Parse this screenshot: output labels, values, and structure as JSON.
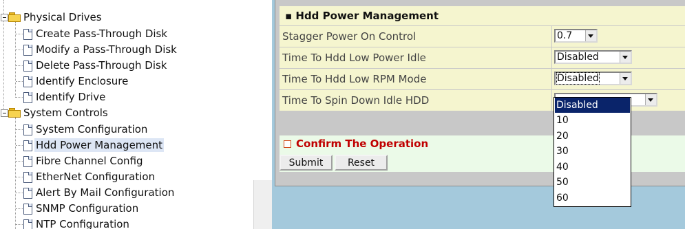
{
  "tree": {
    "groups": [
      {
        "label": "Physical Drives",
        "items": [
          "Create Pass-Through Disk",
          "Modify a Pass-Through Disk",
          "Delete Pass-Through Disk",
          "Identify Enclosure",
          "Identify Drive"
        ]
      },
      {
        "label": "System Controls",
        "items": [
          "System Configuration",
          "Hdd Power Management",
          "Fibre Channel Config",
          "EtherNet Configuration",
          "Alert By Mail Configuration",
          "SNMP Configuration",
          "NTP Configuration"
        ]
      }
    ],
    "selected_item": "Hdd Power Management"
  },
  "panel": {
    "title": "Hdd Power Management",
    "fields": [
      {
        "label": "Stagger Power On Control",
        "value": "0.7"
      },
      {
        "label": "Time To Hdd Low Power Idle",
        "value": "Disabled"
      },
      {
        "label": "Time To Hdd Low RPM Mode",
        "value": "Disabled"
      },
      {
        "label": "Time To Spin Down Idle HDD",
        "value": ""
      }
    ],
    "confirm_label": "Confirm The Operation",
    "submit_label": "Submit",
    "reset_label": "Reset"
  },
  "dropdown": {
    "options": [
      "Disabled",
      "10",
      "20",
      "30",
      "40",
      "50",
      "60"
    ],
    "highlighted": "Disabled"
  },
  "colors": {
    "field_bg": "#f5f5cf",
    "confirm_bg": "#ebfae8",
    "confirm_text": "#c00000",
    "highlight": "#0a246a",
    "outer_bg": "#a4c9dc"
  }
}
